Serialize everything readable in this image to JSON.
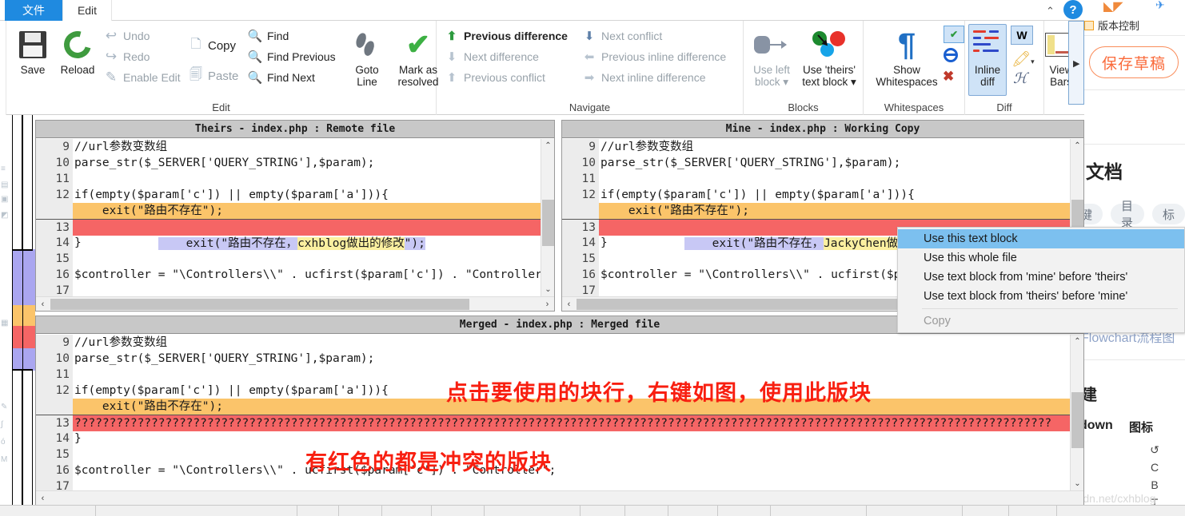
{
  "window": {
    "tabs": [
      {
        "label": "文件",
        "active": true
      },
      {
        "label": "Edit",
        "active": false
      }
    ],
    "collapse_ribbon_icon": "chevron-up-icon",
    "help_icon": "?"
  },
  "ribbon": {
    "groups": [
      {
        "name": "Edit",
        "label": "Edit",
        "big_buttons": [
          {
            "label": "Save",
            "icon": "floppy-disk-icon",
            "enabled": true
          },
          {
            "label": "Reload",
            "icon": "reload-circular-arrows-icon",
            "enabled": true
          }
        ],
        "small_buttons": [
          {
            "label": "Undo",
            "icon": "undo-arrow-icon",
            "enabled": false
          },
          {
            "label": "Redo",
            "icon": "redo-arrow-icon",
            "enabled": false
          },
          {
            "label": "Enable Edit",
            "icon": "enable-edit-icon",
            "enabled": false
          },
          {
            "label": "Copy",
            "icon": "copy-icon",
            "enabled": true
          },
          {
            "label": "Paste",
            "icon": "paste-icon",
            "enabled": false
          },
          {
            "label": "Find",
            "icon": "magnifier-icon",
            "enabled": true
          },
          {
            "label": "Find Previous",
            "icon": "magnifier-icon",
            "enabled": true
          },
          {
            "label": "Find Next",
            "icon": "magnifier-icon",
            "enabled": true
          }
        ],
        "big_buttons_2": [
          {
            "label": "Goto Line",
            "line1": "Goto",
            "line2": "Line",
            "icon": "footsteps-icon"
          },
          {
            "label": "Mark as resolved",
            "line1": "Mark as",
            "line2": "resolved",
            "icon": "green-check-icon"
          }
        ]
      },
      {
        "name": "Navigate",
        "label": "Navigate",
        "items": [
          {
            "label": "Previous difference",
            "icon": "arrow-up-icon",
            "enabled": true
          },
          {
            "label": "Next difference",
            "icon": "arrow-down-icon",
            "enabled": false
          },
          {
            "label": "Previous conflict",
            "icon": "arrow-up-icon",
            "enabled": false
          },
          {
            "label": "Next conflict",
            "icon": "arrow-down-icon",
            "enabled": true
          },
          {
            "label": "Previous inline difference",
            "icon": "arrow-left-inline-icon",
            "enabled": false
          },
          {
            "label": "Next inline difference",
            "icon": "arrow-right-inline-icon",
            "enabled": false
          }
        ]
      },
      {
        "name": "Blocks",
        "label": "Blocks",
        "buttons": [
          {
            "line1": "Use left",
            "line2": "block",
            "icon": "use-left-block-icon",
            "enabled": false,
            "has_dropdown": true
          },
          {
            "line1": "Use 'theirs'",
            "line2": "text block",
            "icon": "use-theirs-block-icon",
            "enabled": true,
            "has_dropdown": true
          }
        ]
      },
      {
        "name": "Whitespaces",
        "label": "Whitespaces",
        "buttons": [
          {
            "line1": "Show",
            "line2": "Whitespaces",
            "icon": "pilcrow-icon",
            "enabled": true
          }
        ],
        "mini_icons": [
          {
            "name": "checked-lines-icon",
            "selected": true
          },
          {
            "name": "no-entry-circle-icon",
            "selected": false
          },
          {
            "name": "red-x-icon",
            "selected": false
          }
        ]
      },
      {
        "name": "Diff",
        "label": "Diff",
        "buttons": [
          {
            "line1": "Inline",
            "line2": "diff",
            "icon": "inline-diff-icon",
            "toggled": true
          }
        ],
        "mini_icons": [
          {
            "name": "word-diff-icon",
            "selected": true
          },
          {
            "name": "highlight-filter-icon",
            "selected": false,
            "has_dropdown": true
          },
          {
            "name": "ignore-case-icon",
            "selected": false
          }
        ]
      },
      {
        "name": "View",
        "label": "",
        "buttons": [
          {
            "line1": "View",
            "line2": "Bars",
            "icon": "view-bars-icon",
            "has_dropdown": true
          }
        ]
      }
    ]
  },
  "panes": {
    "theirs": {
      "title": "Theirs - index.php : Remote file",
      "lines": [
        {
          "num": "9",
          "marker": "",
          "text": "//url参数变数组",
          "style": "plain"
        },
        {
          "num": "10",
          "marker": "",
          "text": "parse_str($_SERVER['QUERY_STRING'],$param);",
          "style": "plain"
        },
        {
          "num": "11",
          "marker": "",
          "text": "",
          "style": "plain"
        },
        {
          "num": "12",
          "marker": "",
          "text": "if(empty($param['c']) || empty($param['a'])){",
          "style": "plain"
        },
        {
          "num": "",
          "marker": "=",
          "text": "    exit(\"路由不存在\");",
          "style": "orange"
        },
        {
          "num": "13",
          "marker": "+",
          "text": "    exit(\"路由不存在，cxhblog做出的修改\");",
          "style": "add",
          "highlight": "cxhblog做出的修改"
        },
        {
          "num": "14",
          "marker": "",
          "text": "}",
          "style": "plain"
        },
        {
          "num": "15",
          "marker": "",
          "text": "",
          "style": "plain"
        },
        {
          "num": "16",
          "marker": "",
          "text": "$controller = \"\\Controllers\\\\\" . ucfirst($param['c']) . \"Controller\";",
          "style": "plain"
        },
        {
          "num": "17",
          "marker": "",
          "text": "",
          "style": "plain"
        }
      ]
    },
    "mine": {
      "title": "Mine - index.php : Working Copy",
      "lines": [
        {
          "num": "9",
          "marker": "",
          "text": "//url参数变数组",
          "style": "plain"
        },
        {
          "num": "10",
          "marker": "",
          "text": "parse_str($_SERVER['QUERY_STRING'],$param);",
          "style": "plain"
        },
        {
          "num": "11",
          "marker": "",
          "text": "",
          "style": "plain"
        },
        {
          "num": "12",
          "marker": "",
          "text": "if(empty($param['c']) || empty($param['a'])){",
          "style": "plain"
        },
        {
          "num": "",
          "marker": "=",
          "text": "    exit(\"路由不存在\");",
          "style": "orange"
        },
        {
          "num": "13",
          "marker": "+",
          "text": "    exit(\"路由不存在，JackyChen做出修改\");",
          "style": "add",
          "highlight": "JackyChen做出修改"
        },
        {
          "num": "14",
          "marker": "",
          "text": "}",
          "style": "plain"
        },
        {
          "num": "15",
          "marker": "",
          "text": "",
          "style": "plain"
        },
        {
          "num": "16",
          "marker": "",
          "text": "$controller = \"\\Controllers\\\\\" . ucfirst($pa",
          "style": "plain"
        },
        {
          "num": "17",
          "marker": "",
          "text": "",
          "style": "plain"
        }
      ]
    },
    "merged": {
      "title": "Merged - index.php : Merged file",
      "lines": [
        {
          "num": "9",
          "marker": "",
          "text": "//url参数变数组",
          "style": "plain"
        },
        {
          "num": "10",
          "marker": "",
          "text": "parse_str($_SERVER['QUERY_STRING'],$param);",
          "style": "plain"
        },
        {
          "num": "11",
          "marker": "",
          "text": "",
          "style": "plain"
        },
        {
          "num": "12",
          "marker": "",
          "text": "if(empty($param['c']) || empty($param['a'])){",
          "style": "plain"
        },
        {
          "num": "",
          "marker": "-",
          "text": "    exit(\"路由不存在\");",
          "style": "orange"
        },
        {
          "num": "13",
          "marker": "!",
          "text": "????????????????????????????????????????????????????????????????????????????????????????????????????????????????????????????????????????????",
          "style": "conflict"
        },
        {
          "num": "14",
          "marker": "",
          "text": "}",
          "style": "plain"
        },
        {
          "num": "15",
          "marker": "",
          "text": "",
          "style": "plain"
        },
        {
          "num": "16",
          "marker": "",
          "text": "$controller = \"\\Controllers\\\\\" . ucfirst($param['c']) . \"Controller\";",
          "style": "plain"
        },
        {
          "num": "17",
          "marker": "",
          "text": "",
          "style": "plain"
        }
      ]
    }
  },
  "context_menu": {
    "items": [
      {
        "label": "Use this text block",
        "selected": true,
        "enabled": true
      },
      {
        "label": "Use this whole file",
        "selected": false,
        "enabled": true
      },
      {
        "label": "Use text block from 'mine' before 'theirs'",
        "selected": false,
        "enabled": true
      },
      {
        "label": "Use text block from 'theirs' before 'mine'",
        "selected": false,
        "enabled": true
      },
      {
        "separator": true
      },
      {
        "label": "Copy",
        "selected": false,
        "enabled": false
      }
    ]
  },
  "annotations": [
    {
      "text": "点击要使用的块行，右键如图，使用此版块",
      "color": "#f81f10"
    },
    {
      "text": "有红色的都是冲突的版块",
      "color": "#f81f10"
    }
  ],
  "background_page": {
    "version_control_label": "版本控制",
    "save_draft_button": "保存草稿",
    "doc_heading": "文档",
    "chips": [
      "键",
      "目录",
      "标"
    ],
    "flowchart_label": "Flowchart流程图",
    "jian_label": "建",
    "markdown_label": "down",
    "icon_label": "图标",
    "glyphs": [
      "↺",
      "C",
      "B",
      "T"
    ],
    "watermark": "https://blog.csdn.net/cxhblog"
  },
  "colors": {
    "accent_blue": "#1f8ae0",
    "conflict_red": "#f56565",
    "diff_orange": "#fbc46a",
    "added_lavender": "#c8c8f5",
    "highlight_yellow": "#fbf0a0",
    "annotation_red": "#f81f10",
    "menu_select_blue": "#7cc0ef"
  }
}
